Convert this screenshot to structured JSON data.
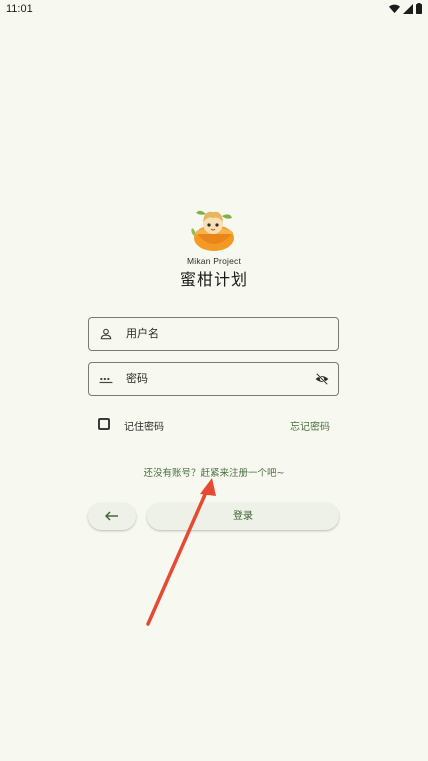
{
  "status_bar": {
    "time": "11:01",
    "icons": [
      "wifi-icon",
      "signal-icon",
      "battery-icon"
    ]
  },
  "app": {
    "logo": "mikan-logo",
    "subtitle": "Mikan Project",
    "title": "蜜柑计划"
  },
  "form": {
    "username": {
      "value": "",
      "placeholder": "用户名",
      "icon": "person-icon"
    },
    "password": {
      "value": "",
      "placeholder": "密码",
      "icon": "password-icon",
      "toggle_icon": "visibility-off-icon"
    },
    "remember_label": "记住密码",
    "remember_checked": false,
    "forgot_label": "忘记密码"
  },
  "register_text": "还没有账号？赶紧来注册一个吧~",
  "buttons": {
    "back_icon": "arrow-back-icon",
    "login_label": "登录"
  },
  "colors": {
    "background": "#f7f9f1",
    "accent_text": "#4a6f3e",
    "annotation_arrow": "#e64a33",
    "field_border": "#7a7a74"
  }
}
